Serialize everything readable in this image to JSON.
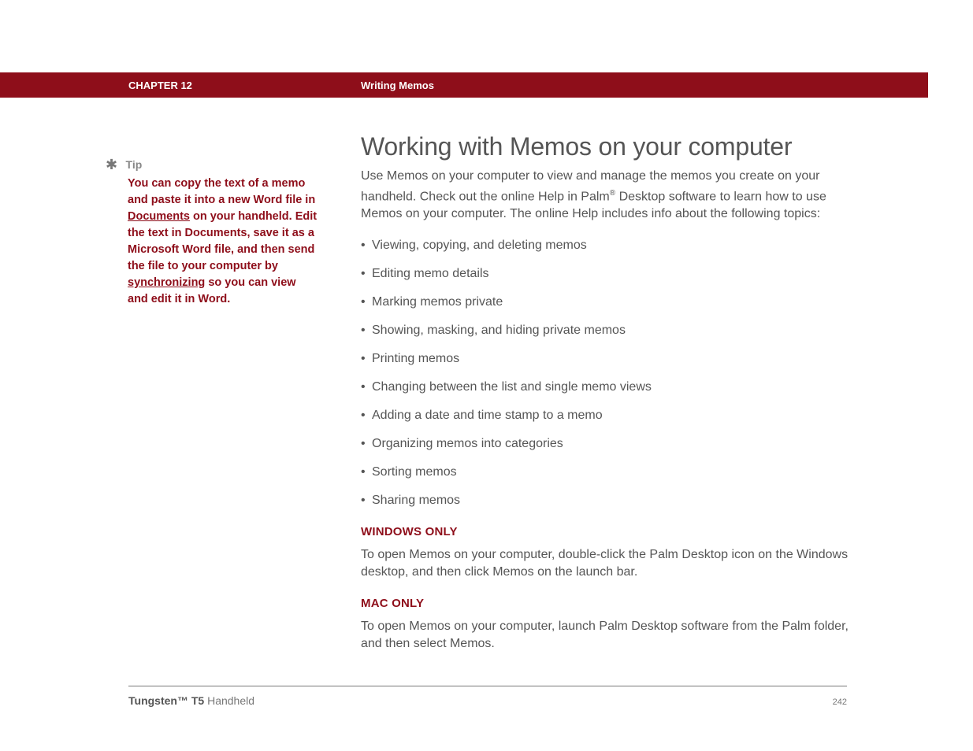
{
  "header": {
    "chapter": "CHAPTER 12",
    "title": "Writing Memos"
  },
  "sidebar": {
    "tip_label": "Tip",
    "tip_part1": "You can copy the text of a memo and paste it into a new Word file in ",
    "tip_link1": "Documents",
    "tip_part2": " on your handheld. Edit the text in Documents, save it as a Microsoft Word file, and then send the file to your computer by ",
    "tip_link2": "synchronizing",
    "tip_part3": " so you can view and edit it in Word."
  },
  "main": {
    "heading": "Working with Memos on your computer",
    "intro_part1": "Use Memos on your computer to view and manage the memos you create on your handheld. Check out the online Help in Palm",
    "intro_sup": "®",
    "intro_part2": " Desktop software to learn how to use Memos on your computer. The online Help includes info about the following topics:",
    "topics": [
      "Viewing, copying, and deleting memos",
      "Editing memo details",
      "Marking memos private",
      "Showing, masking, and hiding private memos",
      "Printing memos",
      "Changing between the list and single memo views",
      "Adding a date and time stamp to a memo",
      "Organizing memos into categories",
      "Sorting memos",
      "Sharing memos"
    ],
    "windows_heading": "WINDOWS ONLY",
    "windows_para": "To open Memos on your computer, double-click the Palm Desktop icon on the Windows desktop, and then click Memos on the launch bar.",
    "mac_heading": "MAC ONLY",
    "mac_para": "To open Memos on your computer, launch Palm Desktop software from the Palm folder, and then select Memos."
  },
  "footer": {
    "device_bold": "Tungsten™ T5",
    "device_rest": " Handheld",
    "page": "242"
  }
}
